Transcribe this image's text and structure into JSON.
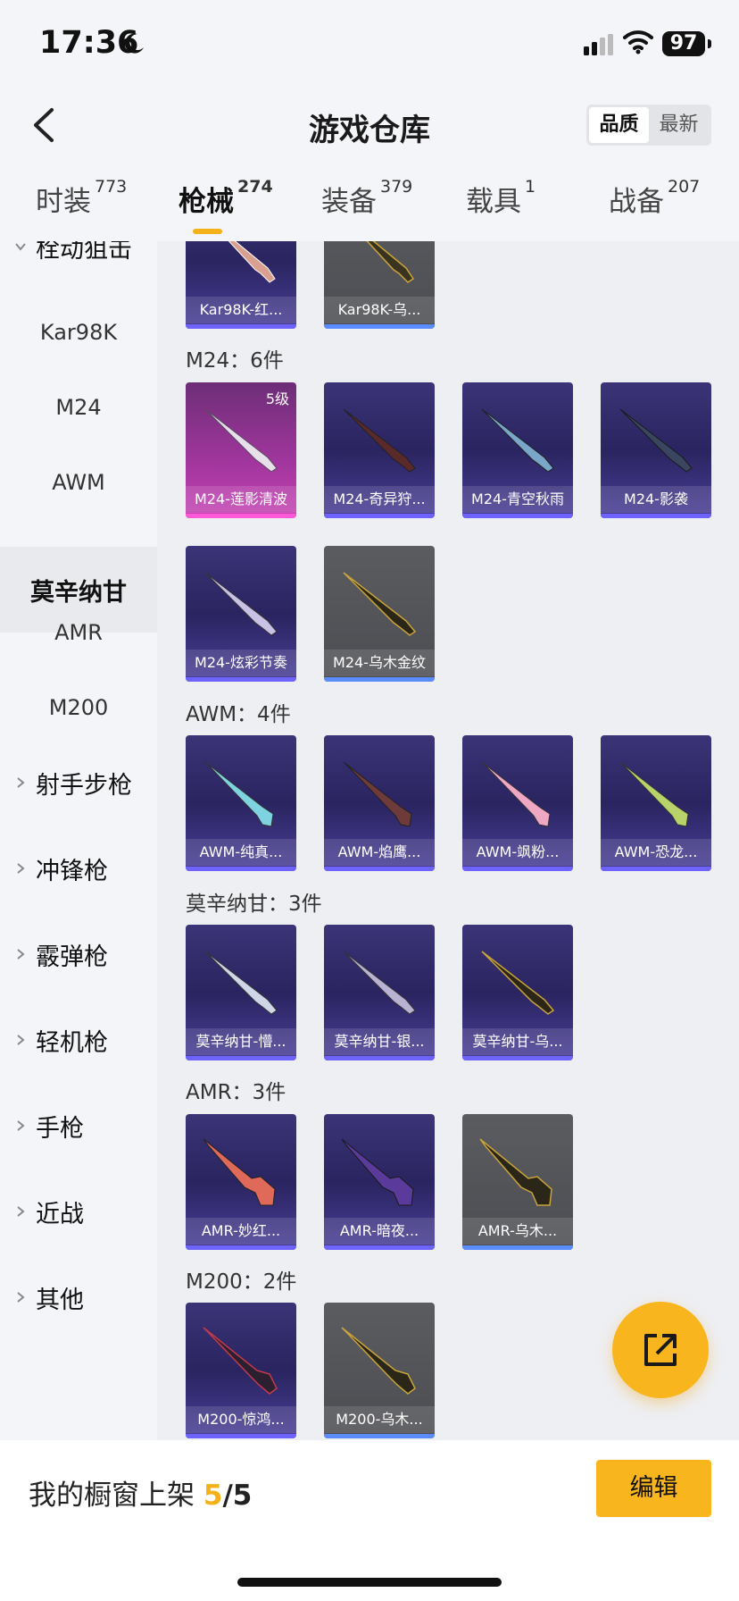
{
  "status_bar": {
    "time": "17:36",
    "battery": "97"
  },
  "header": {
    "title": "游戏仓库",
    "sort_options": [
      "品质",
      "最新"
    ],
    "active_sort": "品质"
  },
  "tabs": [
    {
      "label": "时装",
      "count": "773"
    },
    {
      "label": "枪械",
      "count": "274",
      "active": true
    },
    {
      "label": "装备",
      "count": "379"
    },
    {
      "label": "载具",
      "count": "1"
    },
    {
      "label": "战备",
      "count": "207"
    }
  ],
  "sidebar": {
    "expanded_category": "栓动狙击",
    "subitems": [
      "Kar98K",
      "M24",
      "AWM",
      "莫辛纳甘",
      "AMR",
      "M200"
    ],
    "active_subitem": "莫辛纳甘",
    "categories": [
      "射手步枪",
      "冲锋枪",
      "霰弹枪",
      "轻机枪",
      "手枪",
      "近战",
      "其他"
    ]
  },
  "sections": {
    "kar98k": {
      "cards": [
        "Kar98K-红...",
        "Kar98K-乌..."
      ]
    },
    "m24": {
      "title": "M24：6件",
      "level_badge": "5级",
      "cards": [
        "M24-莲影清波",
        "M24-奇异狩...",
        "M24-青空秋雨",
        "M24-影袭",
        "M24-炫彩节奏",
        "M24-乌木金纹"
      ]
    },
    "awm": {
      "title": "AWM：4件",
      "cards": [
        "AWM-纯真...",
        "AWM-焰鹰...",
        "AWM-飒粉...",
        "AWM-恐龙..."
      ]
    },
    "mosin": {
      "title": "莫辛纳甘：3件",
      "cards": [
        "莫辛纳甘-懵...",
        "莫辛纳甘-银...",
        "莫辛纳甘-乌..."
      ]
    },
    "amr": {
      "title": "AMR：3件",
      "cards": [
        "AMR-妙红...",
        "AMR-暗夜...",
        "AMR-乌木..."
      ]
    },
    "m200": {
      "title": "M200：2件",
      "cards": [
        "M200-惊鸿...",
        "M200-乌木..."
      ]
    }
  },
  "footer": {
    "label": "我的橱窗上架 ",
    "shelved": "5",
    "slash": "/",
    "capacity": "5",
    "edit_button": "编辑"
  },
  "colors": {
    "accent": "#f9b51d",
    "card_purple": "#2a2460",
    "card_gray": "#4c4d52",
    "card_pink": "#a2369e"
  }
}
